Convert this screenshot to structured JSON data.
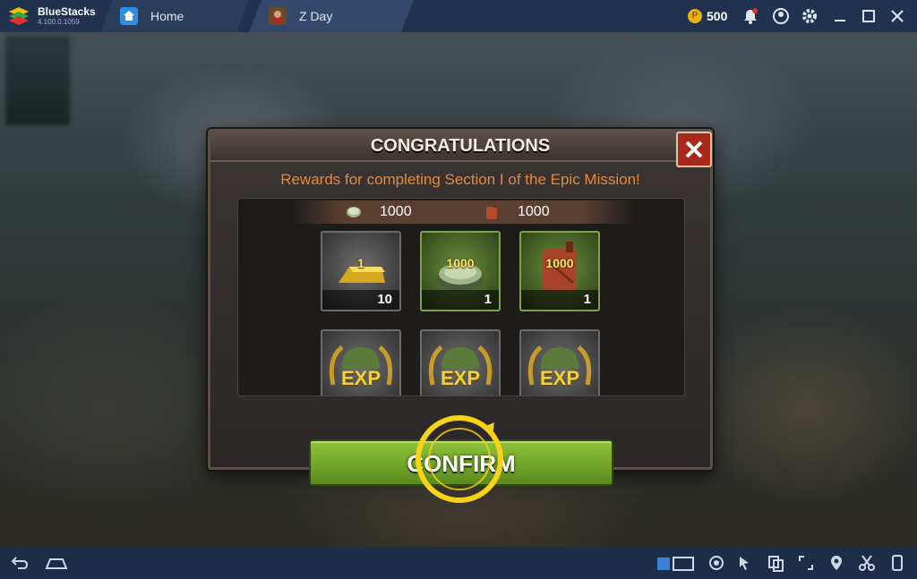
{
  "titlebar": {
    "app_name": "BlueStacks",
    "app_version": "4.100.0.1059",
    "tabs": [
      {
        "label": "Home",
        "icon": "home-icon"
      },
      {
        "label": "Z Day",
        "icon": "z-day-game-icon"
      }
    ],
    "coins": "500",
    "icons": [
      "notification-bell-icon",
      "account-icon",
      "settings-gear-icon",
      "minimize-icon",
      "maximize-icon",
      "close-icon"
    ]
  },
  "dialog": {
    "title": "CONGRATULATIONS",
    "subtitle": "Rewards for completing Section I of the Epic Mission!",
    "totals": [
      {
        "icon": "food-can-icon",
        "amount": "1000"
      },
      {
        "icon": "fuel-jerrycan-icon",
        "amount": "1000"
      }
    ],
    "rewards_row1": [
      {
        "icon": "gold-bar-icon",
        "plate_label": "1",
        "quantity": "10",
        "frame": "grey"
      },
      {
        "icon": "food-can-icon",
        "plate_label": "1000",
        "quantity": "1",
        "frame": "green"
      },
      {
        "icon": "fuel-jerrycan-icon",
        "plate_label": "1000",
        "quantity": "1",
        "frame": "green"
      }
    ],
    "rewards_row2": [
      {
        "icon": "helmet-exp-icon",
        "plate_label": "EXP",
        "frame": "grey"
      },
      {
        "icon": "helmet-exp-icon",
        "plate_label": "EXP",
        "frame": "grey"
      },
      {
        "icon": "helmet-exp-icon",
        "plate_label": "EXP",
        "frame": "grey"
      }
    ],
    "confirm_label": "CONFIRM"
  },
  "bottombar": {
    "left_icons": [
      "back-arrow-icon",
      "home-outline-icon"
    ],
    "right_icons": [
      "keyboard-icon",
      "eye-icon",
      "cursor-icon",
      "multi-instance-icon",
      "resize-icon",
      "location-pin-icon",
      "scissors-icon",
      "rotate-device-icon"
    ]
  },
  "colors": {
    "titlebar_bg": "#20324f",
    "accent_orange": "#e58a3a",
    "confirm_green": "#7ab32e",
    "close_red": "#a8281a"
  }
}
